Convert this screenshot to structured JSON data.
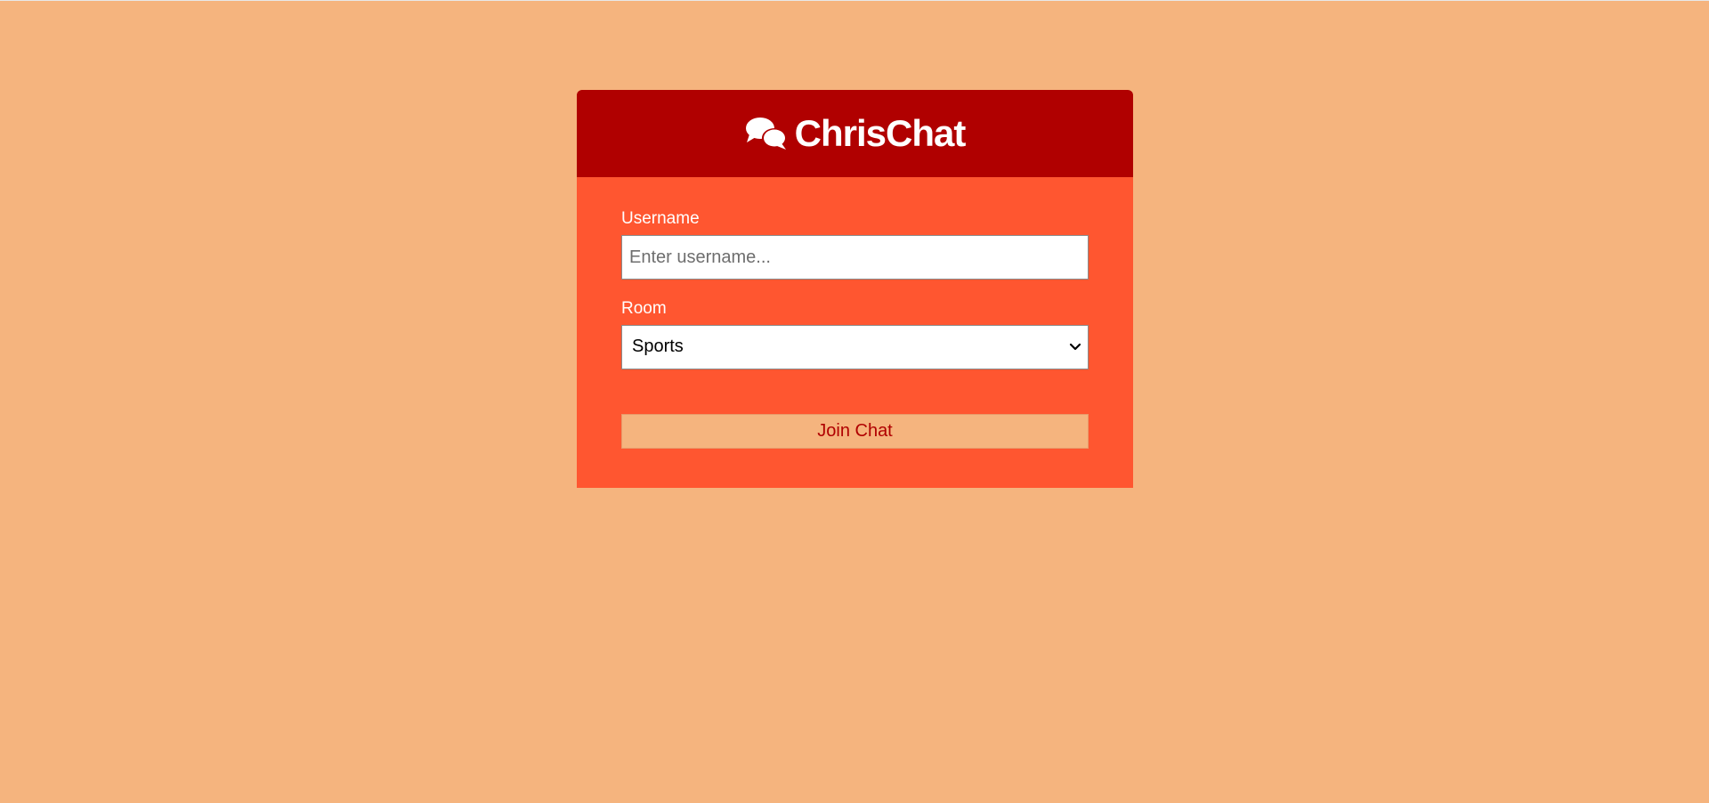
{
  "app": {
    "title": "ChrisChat",
    "logo_icon": "comments-icon"
  },
  "form": {
    "username": {
      "label": "Username",
      "placeholder": "Enter username...",
      "value": ""
    },
    "room": {
      "label": "Room",
      "selected": "Sports"
    },
    "submit_label": "Join Chat"
  },
  "colors": {
    "page_background": "#f5b47e",
    "header_background": "#b00000",
    "form_background": "#ff5630",
    "button_text": "#b00000"
  }
}
